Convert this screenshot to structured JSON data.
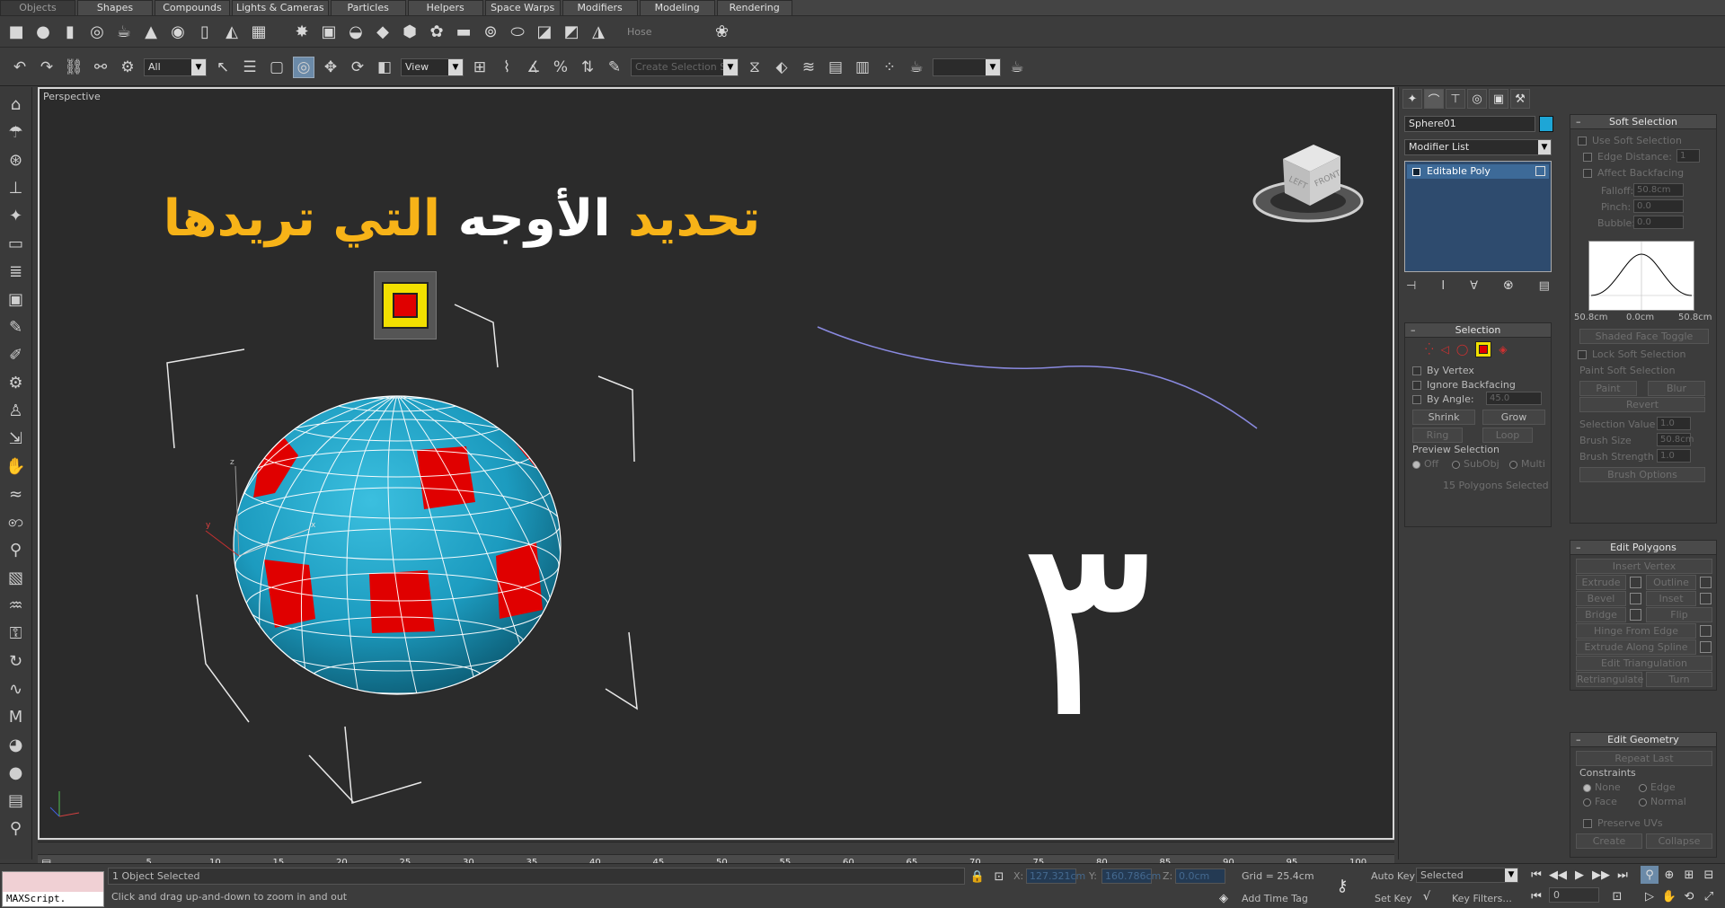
{
  "tabs": [
    "Objects",
    "Shapes",
    "Compounds",
    "Lights & Cameras",
    "Particles",
    "Helpers",
    "Space Warps",
    "Modifiers",
    "Modeling",
    "Rendering"
  ],
  "active_tab": 0,
  "objrow": {
    "hose_label": "Hose",
    "icons": [
      "box-icon",
      "sphere-icon",
      "cylinder-icon",
      "torus-icon",
      "teapot-icon",
      "cone-icon",
      "geosphere-icon",
      "tube-icon",
      "pyramid-icon",
      "plane-icon"
    ]
  },
  "toolbar": {
    "selection_filter": "All",
    "ref_coord": "View",
    "named_selection": "Create Selection Se"
  },
  "viewport": {
    "label": "Perspective",
    "headline_part1": "تحديد",
    "headline_part2": "الأوجه",
    "headline_part3": "التي تريدها",
    "big_number": "٣",
    "viewcube_left": "LEFT",
    "viewcube_front": "FRONT",
    "accent_yellow": "#f7b318",
    "sphere_color": "#1c9bbf",
    "selected_face_color": "#e00000"
  },
  "right_panel": {
    "object_name": "Sphere01",
    "object_color": "#1ea6d6",
    "modifier_list": "Modifier List",
    "stack_item": "Editable Poly",
    "selection": {
      "title": "Selection",
      "by_vertex": "By Vertex",
      "ignore_backfacing": "Ignore Backfacing",
      "by_angle": "By Angle:",
      "by_angle_value": "45.0",
      "shrink": "Shrink",
      "grow": "Grow",
      "ring": "Ring",
      "loop": "Loop",
      "preview_selection": "Preview Selection",
      "off": "Off",
      "subobj": "SubObj",
      "multi": "Multi",
      "status": "15 Polygons Selected"
    },
    "soft_selection": {
      "title": "Soft Selection",
      "use_soft": "Use Soft Selection",
      "edge_distance": "Edge Distance:",
      "edge_distance_value": "1",
      "affect_backfacing": "Affect Backfacing",
      "falloff": "Falloff:",
      "falloff_value": "50.8cm",
      "pinch": "Pinch:",
      "pinch_value": "0.0",
      "bubble": "Bubble:",
      "bubble_value": "0.0",
      "curve_left": "50.8cm",
      "curve_mid": "0.0cm",
      "curve_right": "50.8cm",
      "shaded_face_toggle": "Shaded Face Toggle",
      "lock_soft": "Lock Soft Selection",
      "paint_soft": "Paint Soft Selection",
      "paint": "Paint",
      "blur": "Blur",
      "revert": "Revert",
      "selection_value": "Selection Value",
      "selection_value_num": "1.0",
      "brush_size": "Brush Size",
      "brush_size_num": "50.8cm",
      "brush_strength": "Brush Strength",
      "brush_strength_num": "1.0",
      "brush_options": "Brush Options"
    },
    "edit_polygons": {
      "title": "Edit Polygons",
      "insert_vertex": "Insert Vertex",
      "extrude": "Extrude",
      "outline": "Outline",
      "bevel": "Bevel",
      "inset": "Inset",
      "bridge": "Bridge",
      "flip": "Flip",
      "hinge": "Hinge From Edge",
      "extrude_spline": "Extrude Along Spline",
      "edit_tri": "Edit Triangulation",
      "retriangulate": "Retriangulate",
      "turn": "Turn"
    },
    "edit_geometry": {
      "title": "Edit Geometry",
      "repeat_last": "Repeat Last",
      "constraints": "Constraints",
      "none": "None",
      "edge": "Edge",
      "face": "Face",
      "normal": "Normal",
      "preserve_uvs": "Preserve UVs",
      "create": "Create",
      "collapse": "Collapse"
    }
  },
  "timeline": {
    "ticks": [
      "5",
      "10",
      "15",
      "20",
      "25",
      "30",
      "35",
      "40",
      "45",
      "50",
      "55",
      "60",
      "65",
      "70",
      "75",
      "80",
      "85",
      "90",
      "95",
      "100"
    ]
  },
  "status": {
    "maxscript": "MAXScript.",
    "objects_selected": "1 Object Selected",
    "prompt": "Click and drag up-and-down to zoom in and out",
    "x_label": "X:",
    "x_value": "127.321cm",
    "y_label": "Y:",
    "y_value": "160.786cm",
    "z_label": "Z:",
    "z_value": "0.0cm",
    "grid": "Grid = 25.4cm",
    "add_time_tag": "Add Time Tag",
    "auto_key": "Auto Key",
    "set_key": "Set Key",
    "key_mode": "Selected",
    "key_filters": "Key Filters...",
    "frame": "0"
  }
}
